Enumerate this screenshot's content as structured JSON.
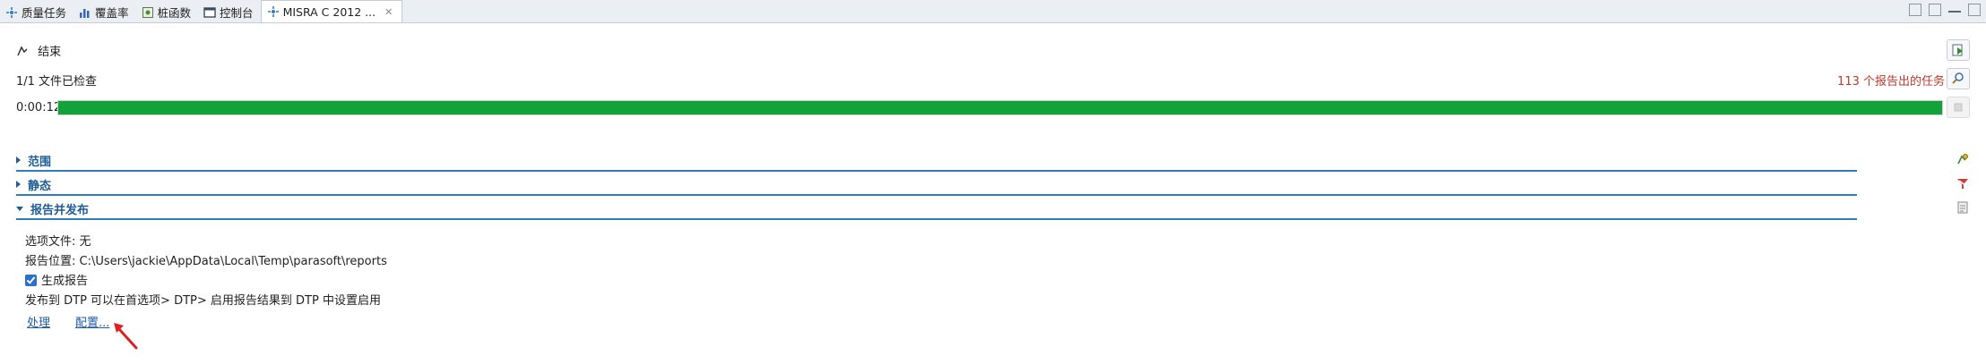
{
  "tabs": [
    {
      "label": "质量任务",
      "icon": "quality-tasks-icon"
    },
    {
      "label": "覆盖率",
      "icon": "coverage-chart-icon"
    },
    {
      "label": "桩函数",
      "icon": "stub-function-icon"
    },
    {
      "label": "控制台",
      "icon": "console-icon"
    },
    {
      "label": "MISRA C 2012 ...",
      "icon": "misra-test-icon",
      "close": "✕"
    }
  ],
  "status": {
    "state_label": "结束",
    "files_checked": "1/1 文件已检查",
    "tasks_reported": "113 个报告出的任务",
    "elapsed": "0:00:12",
    "progress_fraction": 1.0
  },
  "sections": [
    {
      "label": "范围",
      "expanded": false
    },
    {
      "label": "静态",
      "expanded": false
    },
    {
      "label": "报告并发布",
      "expanded": true
    }
  ],
  "report": {
    "options_file": "选项文件: 无",
    "report_location": "报告位置: C:\\Users\\jackie\\AppData\\Local\\Temp\\parasoft\\reports",
    "generate_report_label": "生成报告",
    "generate_report_checked": true,
    "publish_note": "发布到 DTP 可以在首选项> DTP> 启用报告结果到 DTP 中设置启用",
    "process_link": "处理",
    "configure_link": "配置..."
  },
  "colors": {
    "progress": "#12a23a",
    "section_accent": "#2e7dbd",
    "tasks_text": "#c0392b",
    "annotation_arrow": "#e02020"
  }
}
